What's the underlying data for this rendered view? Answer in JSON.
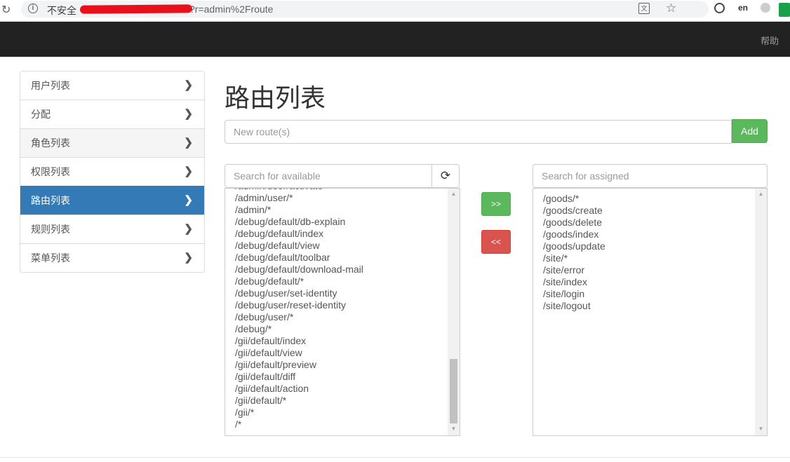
{
  "browser": {
    "not_secure_label": "不安全",
    "url_tail": "?r=admin%2Froute"
  },
  "navbar": {
    "help_label": "帮助"
  },
  "sidebar": {
    "items": [
      {
        "label": "用户列表"
      },
      {
        "label": "分配"
      },
      {
        "label": "角色列表"
      },
      {
        "label": "权限列表"
      },
      {
        "label": "路由列表"
      },
      {
        "label": "规则列表"
      },
      {
        "label": "菜单列表"
      }
    ]
  },
  "main": {
    "title": "路由列表",
    "new_route_placeholder": "New route(s)",
    "add_label": "Add",
    "search_available_placeholder": "Search for available",
    "search_assigned_placeholder": "Search for assigned",
    "assign_label": ">>",
    "remove_label": "<<",
    "available_routes": [
      "/admin/user/activate",
      "/admin/user/*",
      "/admin/*",
      "/debug/default/db-explain",
      "/debug/default/index",
      "/debug/default/view",
      "/debug/default/toolbar",
      "/debug/default/download-mail",
      "/debug/default/*",
      "/debug/user/set-identity",
      "/debug/user/reset-identity",
      "/debug/user/*",
      "/debug/*",
      "/gii/default/index",
      "/gii/default/view",
      "/gii/default/preview",
      "/gii/default/diff",
      "/gii/default/action",
      "/gii/default/*",
      "/gii/*",
      "/*"
    ],
    "assigned_routes": [
      "/goods/*",
      "/goods/create",
      "/goods/delete",
      "/goods/index",
      "/goods/update",
      "/site/*",
      "/site/error",
      "/site/index",
      "/site/login",
      "/site/logout"
    ]
  }
}
